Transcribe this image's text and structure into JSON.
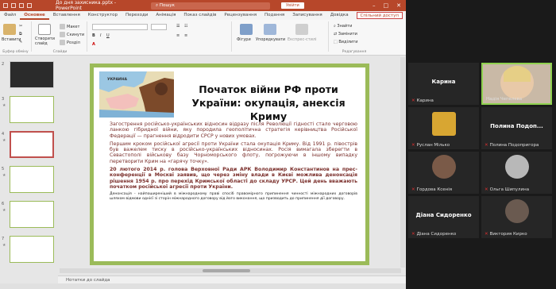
{
  "titlebar": {
    "doc_title": "До дня захисника.pptx - PowerPoint",
    "search": "Пошук",
    "signin": "Увійти"
  },
  "tabs": [
    "Файл",
    "Основне",
    "Вставлення",
    "Конструктор",
    "Переходи",
    "Анімація",
    "Показ слайдів",
    "Рецензування",
    "Подання",
    "Записування",
    "Довідка"
  ],
  "share": "Спільний доступ",
  "ribbon": {
    "paste": "Вставити",
    "clipboard": "Буфер обміну",
    "new_slide": "Створити слайд",
    "layout": "Макет",
    "reset": "Скинути",
    "section": "Розділ",
    "slides": "Слайди",
    "shapes": "Фігури",
    "arrange": "Упорядкувати",
    "quick_styles": "Експрес-стилі",
    "find": "Знайти",
    "replace": "Замінити",
    "select": "Виділити",
    "editing": "Редагування"
  },
  "thumb_numbers": [
    "2",
    "3",
    "4",
    "5",
    "6",
    "7"
  ],
  "slide": {
    "title": "Початок війни РФ проти України: окупація, анексія Криму",
    "map_caption": "УКРАИНА",
    "p1": "Загострення російсько-українських відносин відразу після Революції гідності стало черговою ланкою гібридної війни, яку породила геополітична стратегія керівництва Російської Федерації — прагнення відродити СРСР у нових умовах.",
    "p2": "Першим кроком російської агресії проти України стала окупація Криму. Від 1991 р. півострів був важелем тиску в російсько-українських відносинах. Росія вимагала зберегти в Севастополі військову базу Чорноморського флоту, погрожуючи в іншому випадку перетворити Крим на «гарячу точку».",
    "p3": "20 лютого 2014 р. голова Верховної Ради АРК Володимир Константинов на прес-конференції в Москві заявив, що через зміну влади в Києві можлива денонсація рішення 1954 р. про перехід Кримської області до складу УРСР. Цей день вважають початком російської агресії проти України.",
    "p4": "Денонсація - найпоширеніший в міжнародному праві спосіб правомірного припинення чинності міжнародних договорів шляхом відмови однієї зі сторін міжнародного договору від його виконання, що призводить до припинення дії договору."
  },
  "notes": "Нотатки до слайда",
  "zoom": {
    "tiles": [
      {
        "big": "Карина",
        "name": "Карина"
      },
      {
        "name": "Надія Чепелєва"
      },
      {
        "name": "Руслан Мілько"
      },
      {
        "big": "Полина  Подоп...",
        "name": "Полина Подопригора"
      },
      {
        "name": "Гордова Ксенія"
      },
      {
        "name": "Ольга Шипулина"
      },
      {
        "big": "Діана Сидоренко",
        "name": "Діана Сидоренко"
      },
      {
        "name": "Виктория Кирко"
      }
    ]
  },
  "colors": {
    "ppt_red": "#b7472a",
    "slide_border": "#9bbb59",
    "text_dark_red": "#7a2e2a",
    "speaker_green": "#8fd14f"
  }
}
